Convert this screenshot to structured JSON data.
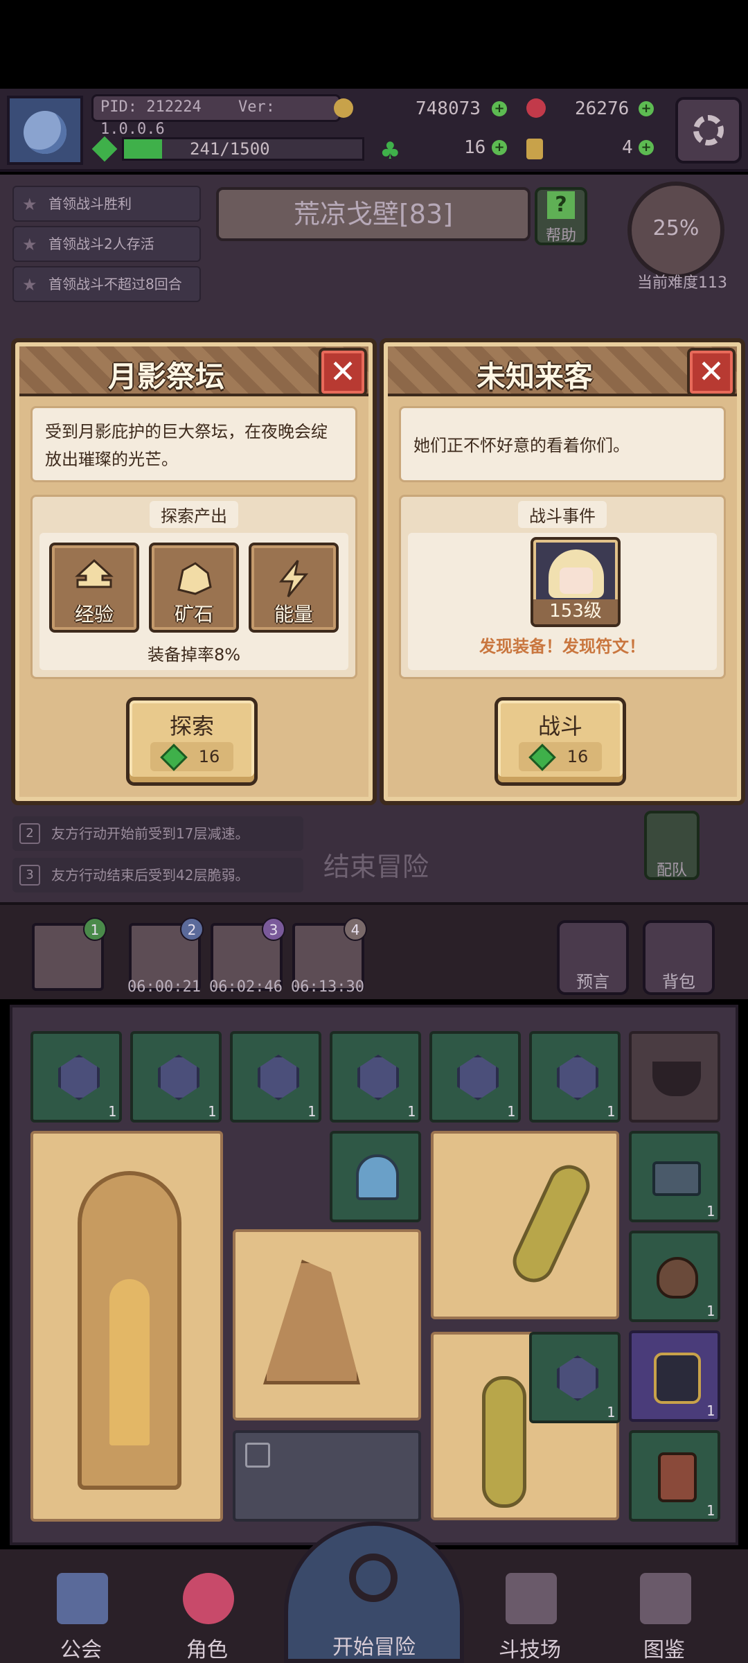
{
  "header": {
    "pid": "PID: 212224",
    "version": "Ver: 1.0.0.6",
    "gold": "748073",
    "gems_red": "26276",
    "stamina": "241/1500",
    "clover": "16",
    "keys": "4",
    "stamina_fraction": 0.16
  },
  "quests": [
    "首领战斗胜利",
    "首领战斗2人存活",
    "首领战斗不超过8回合"
  ],
  "zone": {
    "name": "荒凉戈壁[83]",
    "help_label": "帮助"
  },
  "difficulty": {
    "percent": "25%",
    "label": "当前难度113"
  },
  "panel_left": {
    "title": "月影祭坛",
    "description": "受到月影庇护的巨大祭坛，在夜晚会绽放出璀璨的光芒。",
    "section_label": "探索产出",
    "rewards": [
      "经验",
      "矿石",
      "能量"
    ],
    "drop_rate": "装备掉率8%",
    "action_label": "探索",
    "action_cost": "16"
  },
  "panel_right": {
    "title": "未知来客",
    "description": "她们正不怀好意的看着你们。",
    "section_label": "战斗事件",
    "enemy_level": "153级",
    "find_text": "发现装备！发现符文！",
    "action_label": "战斗",
    "action_cost": "16"
  },
  "buffs": [
    {
      "n": "2",
      "text": "友方行动开始前受到17层减速。"
    },
    {
      "n": "3",
      "text": "友方行动结束后受到42层脆弱。"
    }
  ],
  "end_label": "结束冒险",
  "team_label": "配队",
  "expeditions": {
    "slots": [
      "1",
      "2",
      "3",
      "4"
    ],
    "timers": [
      "06:00:21",
      "06:02:46",
      "06:13:30"
    ],
    "prophecy_label": "预言",
    "bag_label": "背包"
  },
  "grid": {
    "gem_counts": [
      "1",
      "1",
      "1",
      "1",
      "1",
      "1"
    ],
    "side_counts": [
      "1",
      "1",
      "1",
      "1"
    ],
    "mid_gem_count": "1"
  },
  "nav": {
    "guild": "公会",
    "character": "角色",
    "start": "开始冒险",
    "arena": "斗技场",
    "codex": "图鉴"
  },
  "colors": {
    "panel": "#dcbc8c",
    "accent_green": "#3fb04a",
    "close_red": "#b83a32",
    "find_orange": "#c9763e"
  }
}
